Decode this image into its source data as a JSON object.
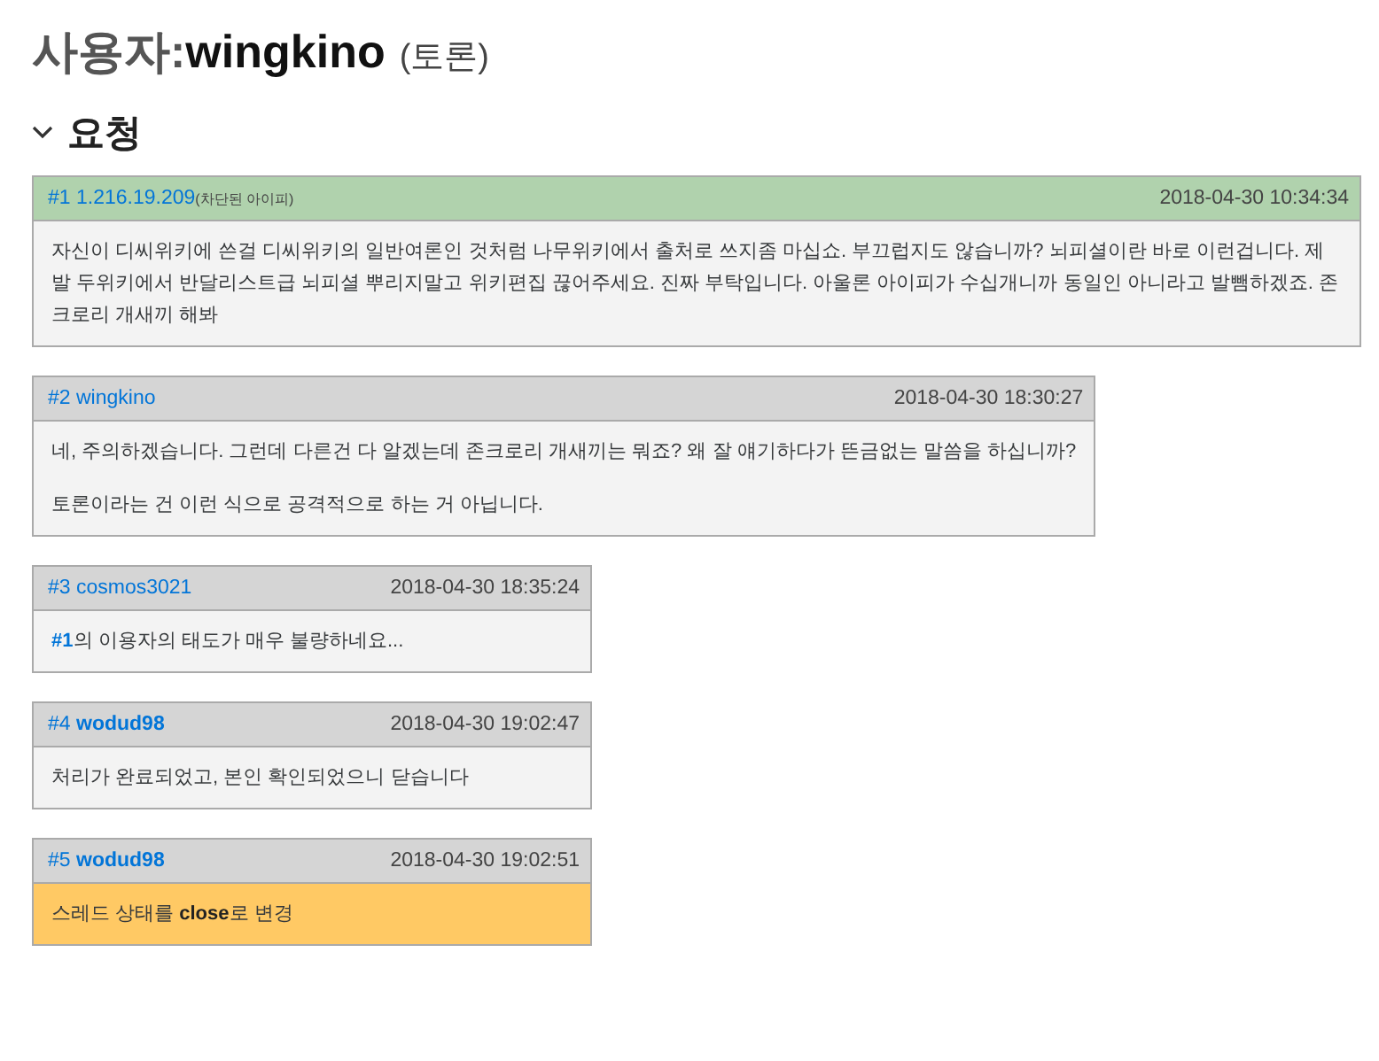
{
  "title": {
    "prefix": "사용자:",
    "name": "wingkino",
    "suffix": "(토론)"
  },
  "section": {
    "title": "요청",
    "expanded": true
  },
  "comments": [
    {
      "number": "#1",
      "author": "1.216.19.209",
      "author_bold": false,
      "note": "(차단된 아이피)",
      "time": "2018-04-30 10:34:34",
      "starter": true,
      "kind": "text",
      "paragraphs": [
        "자신이 디씨위키에 쓴걸 디씨위키의 일반여론인 것처럼 나무위키에서 출처로 쓰지좀 마십쇼. 부끄럽지도 않습니까? 뇌피셜이란 바로 이런겁니다. 제발 두위키에서 반달리스트급 뇌피셜 뿌리지말고 위키편집 끊어주세요. 진짜 부탁입니다. 아울론 아이피가 수십개니까 동일인 아니라고 발뺌하겠죠. 존크로리 개새끼 해봐"
      ]
    },
    {
      "number": "#2",
      "author": "wingkino",
      "author_bold": false,
      "time": "2018-04-30 18:30:27",
      "starter": false,
      "kind": "text",
      "paragraphs": [
        "네, 주의하겠습니다. 그런데 다른건 다 알겠는데 존크로리 개새끼는 뭐죠? 왜 잘 얘기하다가 뜬금없는 말씀을 하십니까?",
        "토론이라는 건 이런 식으로 공격적으로 하는 거 아닙니다."
      ]
    },
    {
      "number": "#3",
      "author": "cosmos3021",
      "author_bold": false,
      "time": "2018-04-30 18:35:24",
      "starter": false,
      "kind": "text",
      "paragraphs": [
        "**#1**의 이용자의 태도가 매우 불량하네요..."
      ]
    },
    {
      "number": "#4",
      "author": "wodud98",
      "author_bold": true,
      "time": "2018-04-30 19:02:47",
      "starter": false,
      "kind": "text",
      "paragraphs": [
        "처리가 완료되었고, 본인 확인되었으니 닫습니다"
      ]
    },
    {
      "number": "#5",
      "author": "wodud98",
      "author_bold": true,
      "time": "2018-04-30 19:02:51",
      "starter": false,
      "kind": "status",
      "paragraphs": [
        "스레드 상태를 **close**로 변경"
      ]
    }
  ]
}
